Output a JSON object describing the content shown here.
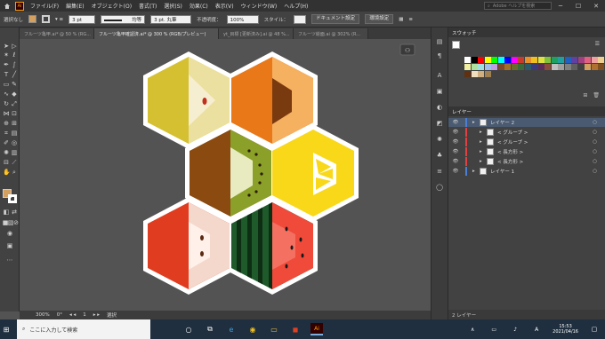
{
  "menubar": {
    "app_icon": "Ai",
    "items": [
      "ファイル(F)",
      "編集(E)",
      "オブジェクト(O)",
      "書式(T)",
      "選択(S)",
      "効果(C)",
      "表示(V)",
      "ウィンドウ(W)",
      "ヘルプ(H)"
    ],
    "search_placeholder": "Adobe ヘルプを検索"
  },
  "controlbar": {
    "selection_label": "選択なし",
    "stroke_weight": "3 pt",
    "stroke_profile": "均等",
    "brush": "3 pt. 丸筆",
    "opacity_label": "不透明度：",
    "opacity_value": "100%",
    "style_label": "スタイル：",
    "doc_setup_button": "ドキュメント設定",
    "prefs_button": "環境設定"
  },
  "tabs": [
    {
      "label": "フルーツ亀甲.ai* @ 50 % (RG...",
      "active": false
    },
    {
      "label": "フルーツ亀甲確認済.ai* @ 300 % (RGB/プレビュー)",
      "active": true
    },
    {
      "label": "yt_目標 [更新済み].ai @ 48 %...",
      "active": false
    },
    {
      "label": "フルーツ絵面.ai @ 302% (R...",
      "active": false
    }
  ],
  "statusbar": {
    "zoom": "300%",
    "angle": "0°",
    "page": "1",
    "tool_label": "選択"
  },
  "swatches_panel": {
    "title": "スウォッチ",
    "colors": [
      "#ffffff",
      "#000000",
      "#ff0000",
      "#ffff00",
      "#00ff00",
      "#00ffff",
      "#0000ff",
      "#ff00ff",
      "#c83a2a",
      "#e8902a",
      "#f0c020",
      "#e0e040",
      "#80c040",
      "#20a060",
      "#20a0a0",
      "#2060c0",
      "#6040a0",
      "#a04080",
      "#e06080",
      "#f0a0a0",
      "#f0d090",
      "#f0f0a0",
      "#b0e0a0",
      "#a0e0e0",
      "#a0c0f0",
      "#c0a0e0",
      "#7a4a2a",
      "#a0702a",
      "#6a6a2a",
      "#3a6a3a",
      "#2a5a6a",
      "#3a3a7a",
      "#5a2a5a",
      "#8a4a3a",
      "#c0c0c0",
      "#a0a0a0",
      "#808080",
      "#606060",
      "#404040",
      "#d4a060",
      "#b07030",
      "#805020",
      "#603010",
      "#f0e0c0",
      "#d0b080",
      "#a08050"
    ]
  },
  "layers_panel": {
    "title": "レイヤー",
    "rows": [
      {
        "name": "レイヤー 2",
        "indent": 0,
        "selected": true,
        "color": "#4a7fd4"
      },
      {
        "name": "< グループ >",
        "indent": 1,
        "selected": false,
        "color": "#e04040"
      },
      {
        "name": "< グループ >",
        "indent": 1,
        "selected": false,
        "color": "#e04040"
      },
      {
        "name": "< 長方形 >",
        "indent": 1,
        "selected": false,
        "color": "#e04040"
      },
      {
        "name": "< 長方形 >",
        "indent": 1,
        "selected": false,
        "color": "#e04040"
      },
      {
        "name": "レイヤー 1",
        "indent": 0,
        "selected": false,
        "color": "#4a7fd4"
      }
    ],
    "footer": "2 レイヤー"
  },
  "taskbar": {
    "search_placeholder": "ここに入力して検索",
    "time": "15:53",
    "date": "2021/04/16",
    "ime": "A"
  },
  "artwork": {
    "hexes": [
      {
        "fruit": "pear",
        "color": "#d4c030"
      },
      {
        "fruit": "orange",
        "color": "#e87818"
      },
      {
        "fruit": "kiwi",
        "color": "#8a4a10"
      },
      {
        "fruit": "lemon",
        "color": "#f8d818"
      },
      {
        "fruit": "apple",
        "color": "#e03c20"
      },
      {
        "fruit": "watermelon",
        "color": "#1e5a2a"
      }
    ]
  }
}
